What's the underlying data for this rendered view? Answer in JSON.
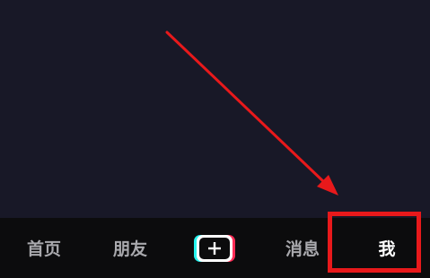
{
  "tabbar": {
    "tabs": [
      {
        "label": "首页"
      },
      {
        "label": "朋友"
      },
      {
        "label": "消息"
      },
      {
        "label": "我"
      }
    ],
    "create_icon": "plus-icon"
  },
  "annotation": {
    "arrow_color": "#e8191b",
    "highlight_color": "#e8191b",
    "highlight_target": "我"
  },
  "colors": {
    "background": "#181827",
    "tabbar_background": "#0c0c0d",
    "tab_inactive": "#a9a9ad",
    "tab_active": "#ffffff",
    "accent_cyan": "#25f4ee",
    "accent_red": "#fe2c55"
  }
}
